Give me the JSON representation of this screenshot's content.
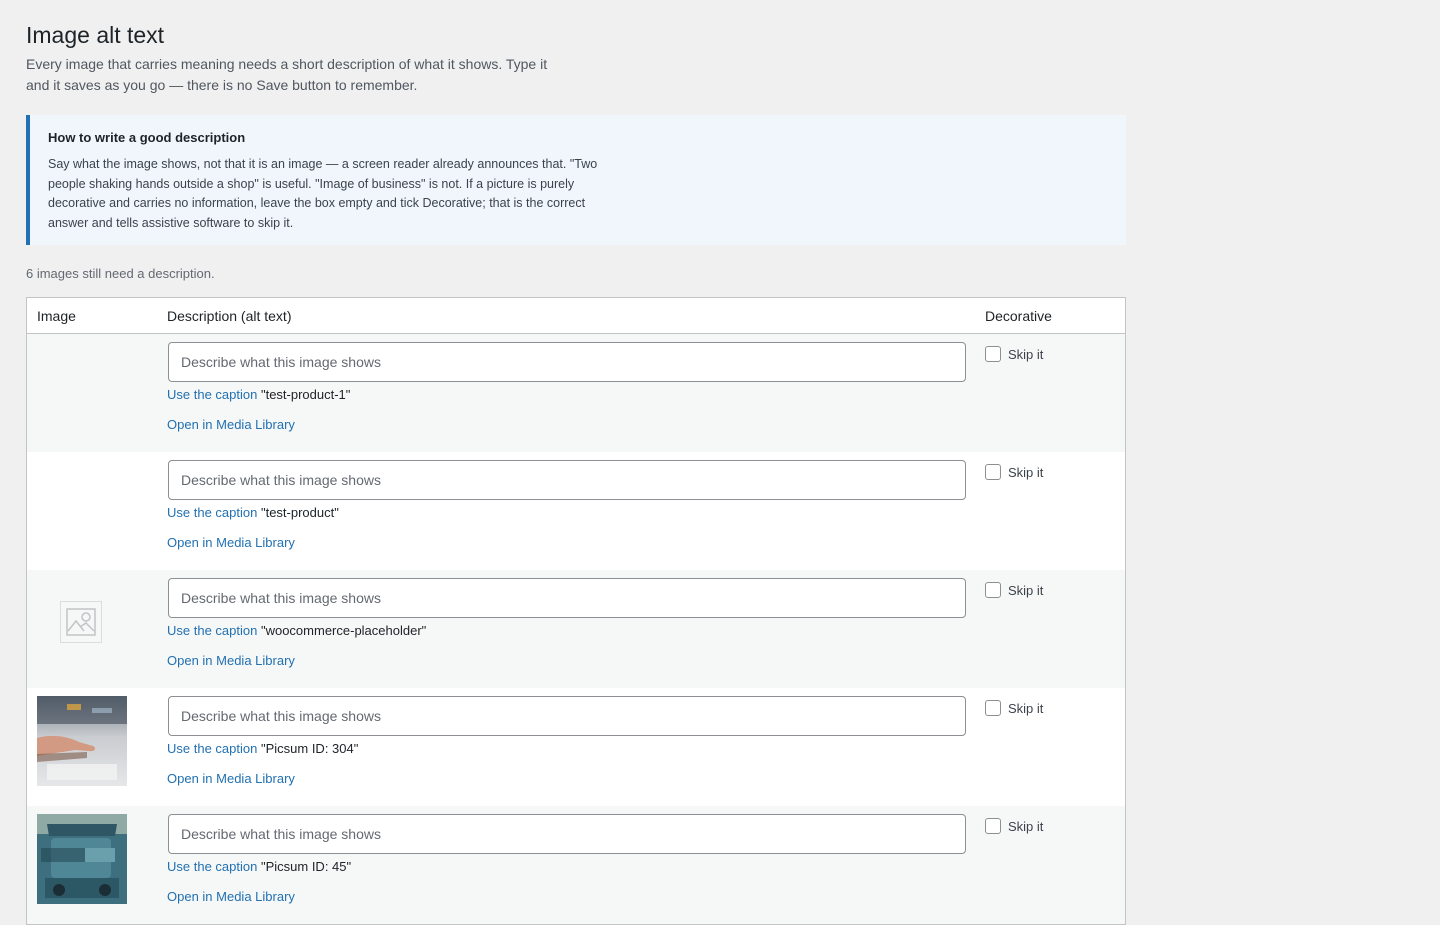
{
  "page": {
    "title": "Image alt text",
    "intro": "Every image that carries meaning needs a short description of what it shows. Type it and it saves as you go — there is no Save button to remember."
  },
  "guide": {
    "title": "How to write a good description",
    "body": "Say what the image shows, not that it is an image — a screen reader already announces that. \"Two people shaking hands outside a shop\" is useful. \"Image of business\" is not. If a picture is purely decorative and carries no information, leave the box empty and tick Decorative; that is the correct answer and tells assistive software to skip it."
  },
  "summary": {
    "remaining": "6 images still need a description."
  },
  "table": {
    "headers": {
      "image": "Image",
      "description": "Description (alt text)",
      "decorative": "Decorative"
    },
    "rows": [
      {
        "thumbnail": "none",
        "placeholder": "Describe what this image shows",
        "value": "",
        "caption_link": "Use the caption",
        "caption": "\"test-product-1\"",
        "media_link": "Open in Media Library",
        "skip_label": "Skip it",
        "skip_checked": false
      },
      {
        "thumbnail": "none",
        "placeholder": "Describe what this image shows",
        "value": "",
        "caption_link": "Use the caption",
        "caption": "\"test-product\"",
        "media_link": "Open in Media Library",
        "skip_label": "Skip it",
        "skip_checked": false
      },
      {
        "thumbnail": "placeholder-image-icon",
        "placeholder": "Describe what this image shows",
        "value": "",
        "caption_link": "Use the caption",
        "caption": "\"woocommerce-placeholder\"",
        "media_link": "Open in Media Library",
        "skip_label": "Skip it",
        "skip_checked": false
      },
      {
        "thumbnail": "photo-hand-on-laptop",
        "placeholder": "Describe what this image shows",
        "value": "",
        "caption_link": "Use the caption",
        "caption": "\"Picsum ID: 304\"",
        "media_link": "Open in Media Library",
        "skip_label": "Skip it",
        "skip_checked": false
      },
      {
        "thumbnail": "photo-tuk-tuk",
        "placeholder": "Describe what this image shows",
        "value": "",
        "caption_link": "Use the caption",
        "caption": "\"Picsum ID: 45\"",
        "media_link": "Open in Media Library",
        "skip_label": "Skip it",
        "skip_checked": false
      }
    ]
  },
  "colors": {
    "accent": "#2271b1",
    "page_bg": "#f0f0f1",
    "guide_bg": "#f0f6fc"
  }
}
